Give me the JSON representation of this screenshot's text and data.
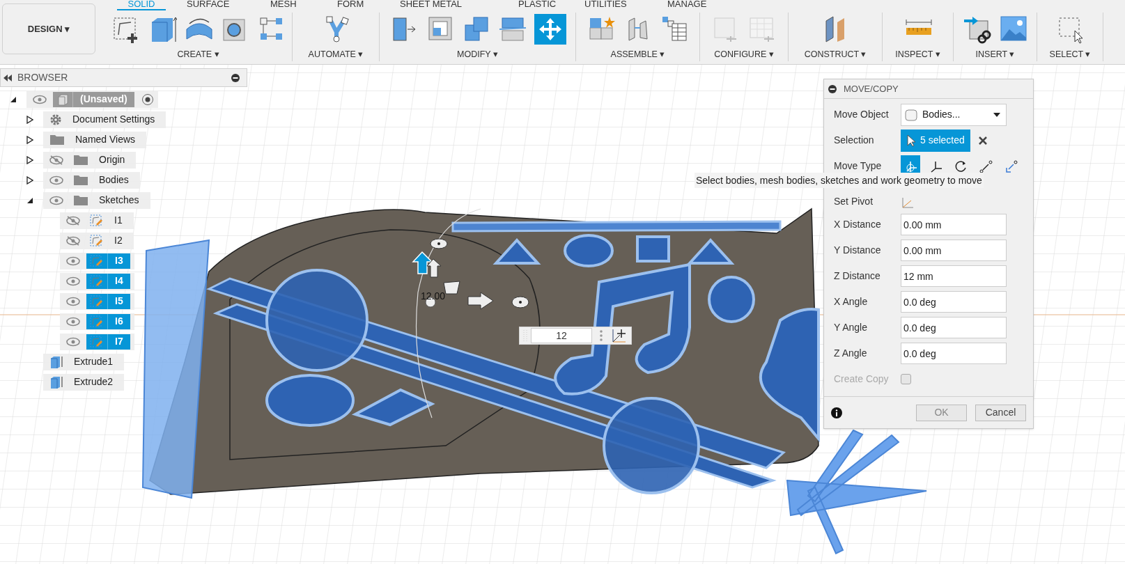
{
  "workspace": {
    "label": "DESIGN ▾"
  },
  "tabs": [
    {
      "label": "SOLID",
      "selected": true
    },
    {
      "label": "SURFACE",
      "selected": false
    },
    {
      "label": "MESH",
      "selected": false
    },
    {
      "label": "FORM",
      "selected": false
    },
    {
      "label": "SHEET METAL",
      "selected": false
    },
    {
      "label": "PLASTIC",
      "selected": false
    },
    {
      "label": "UTILITIES",
      "selected": false
    },
    {
      "label": "MANAGE",
      "selected": false
    }
  ],
  "toolbar_groups": [
    {
      "label": "CREATE ▾"
    },
    {
      "label": "AUTOMATE ▾"
    },
    {
      "label": "MODIFY ▾"
    },
    {
      "label": "ASSEMBLE ▾"
    },
    {
      "label": "CONFIGURE ▾"
    },
    {
      "label": "CONSTRUCT ▾"
    },
    {
      "label": "INSPECT ▾"
    },
    {
      "label": "INSERT ▾"
    },
    {
      "label": "SELECT ▾"
    }
  ],
  "browser": {
    "title": "BROWSER",
    "root": {
      "label": "(Unsaved)",
      "kind": "component",
      "visible": true,
      "expanded": true,
      "active": true,
      "children": [
        {
          "label": "Document Settings",
          "kind": "settings",
          "expanded": false
        },
        {
          "label": "Named Views",
          "kind": "folder",
          "expanded": false
        },
        {
          "label": "Origin",
          "kind": "folder",
          "visible": false,
          "expanded": false
        },
        {
          "label": "Bodies",
          "kind": "folder",
          "visible": true,
          "expanded": false
        },
        {
          "label": "Sketches",
          "kind": "folder",
          "visible": true,
          "expanded": true,
          "children": [
            {
              "label": "I1",
              "kind": "sketch",
              "visible": false,
              "selected": false
            },
            {
              "label": "I2",
              "kind": "sketch",
              "visible": false,
              "selected": false
            },
            {
              "label": "I3",
              "kind": "sketch",
              "visible": true,
              "selected": true
            },
            {
              "label": "I4",
              "kind": "sketch",
              "visible": true,
              "selected": true
            },
            {
              "label": "I5",
              "kind": "sketch",
              "visible": true,
              "selected": true
            },
            {
              "label": "I6",
              "kind": "sketch",
              "visible": true,
              "selected": true
            },
            {
              "label": "I7",
              "kind": "sketch",
              "visible": true,
              "selected": true
            }
          ]
        },
        {
          "label": "Extrude1",
          "kind": "feature"
        },
        {
          "label": "Extrude2",
          "kind": "feature"
        }
      ]
    }
  },
  "viewport": {
    "manipulator_label": "12.00",
    "distance_input": "12"
  },
  "dialog": {
    "title": "MOVE/COPY",
    "rows": [
      {
        "kind": "dropdown",
        "label": "Move Object",
        "value": "Bodies..."
      },
      {
        "kind": "selection",
        "label": "Selection",
        "value": "5 selected"
      },
      {
        "kind": "move_type",
        "label": "Move Type",
        "options": [
          {
            "selected": true
          },
          {
            "selected": false
          },
          {
            "selected": false
          },
          {
            "selected": false
          },
          {
            "selected": false
          }
        ]
      },
      {
        "kind": "pivot",
        "label": "Set Pivot"
      },
      {
        "kind": "input",
        "label": "X Distance",
        "value": "0.00 mm"
      },
      {
        "kind": "input",
        "label": "Y Distance",
        "value": "0.00 mm"
      },
      {
        "kind": "input",
        "label": "Z Distance",
        "value": "12 mm"
      },
      {
        "kind": "input",
        "label": "X Angle",
        "value": "0.0 deg"
      },
      {
        "kind": "input",
        "label": "Y Angle",
        "value": "0.0 deg"
      },
      {
        "kind": "input",
        "label": "Z Angle",
        "value": "0.0 deg"
      },
      {
        "kind": "checkbox",
        "label": "Create Copy",
        "checked": false,
        "disabled": true
      }
    ],
    "buttons": [
      "OK",
      "Cancel"
    ],
    "tooltip": "Select bodies, mesh bodies, sketches and work geometry to move"
  }
}
